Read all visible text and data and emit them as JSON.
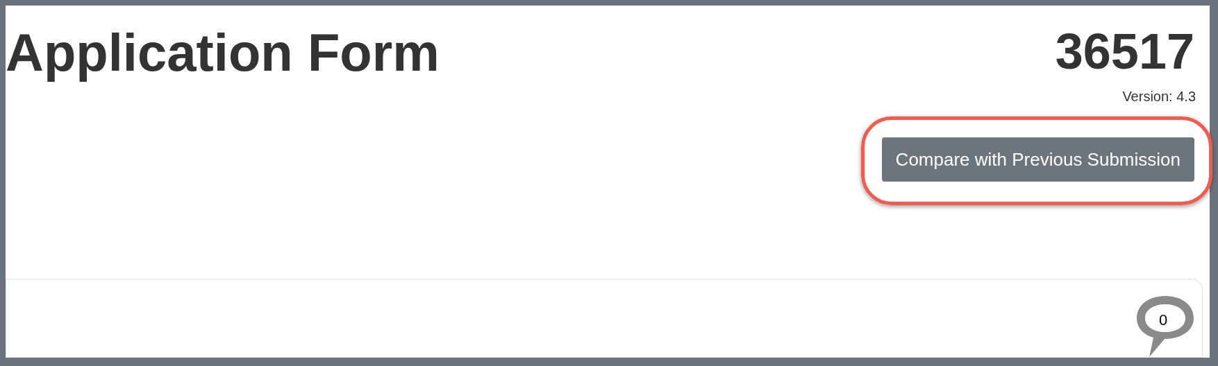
{
  "header": {
    "title": "Application Form",
    "number": "36517",
    "version": "Version: 4.3"
  },
  "compare_button": {
    "label": "Compare with Previous Submission",
    "highlighted": true
  },
  "comments": {
    "count": "0"
  }
}
